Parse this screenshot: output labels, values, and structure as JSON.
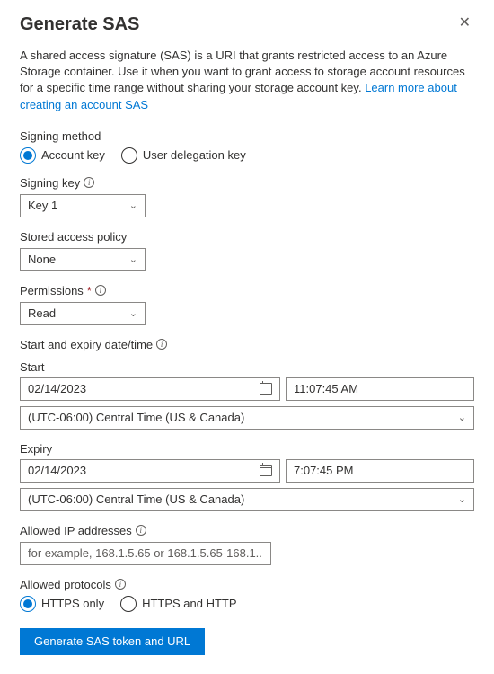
{
  "header": {
    "title": "Generate SAS"
  },
  "description": {
    "text": "A shared access signature (SAS) is a URI that grants restricted access to an Azure Storage container. Use it when you want to grant access to storage account resources for a specific time range without sharing your storage account key. ",
    "link": "Learn more about creating an account SAS"
  },
  "signing_method": {
    "label": "Signing method",
    "options": {
      "account_key": "Account key",
      "user_delegation": "User delegation key"
    },
    "selected": "account_key"
  },
  "signing_key": {
    "label": "Signing key",
    "value": "Key 1"
  },
  "stored_policy": {
    "label": "Stored access policy",
    "value": "None"
  },
  "permissions": {
    "label": "Permissions",
    "value": "Read"
  },
  "datetime": {
    "heading": "Start and expiry date/time",
    "start": {
      "label": "Start",
      "date": "02/14/2023",
      "time": "11:07:45 AM",
      "timezone": "(UTC-06:00) Central Time (US & Canada)"
    },
    "expiry": {
      "label": "Expiry",
      "date": "02/14/2023",
      "time": "7:07:45 PM",
      "timezone": "(UTC-06:00) Central Time (US & Canada)"
    }
  },
  "allowed_ip": {
    "label": "Allowed IP addresses",
    "placeholder": "for example, 168.1.5.65 or 168.1.5.65-168.1...."
  },
  "allowed_protocols": {
    "label": "Allowed protocols",
    "options": {
      "https_only": "HTTPS only",
      "https_and_http": "HTTPS and HTTP"
    },
    "selected": "https_only"
  },
  "submit": {
    "label": "Generate SAS token and URL"
  }
}
